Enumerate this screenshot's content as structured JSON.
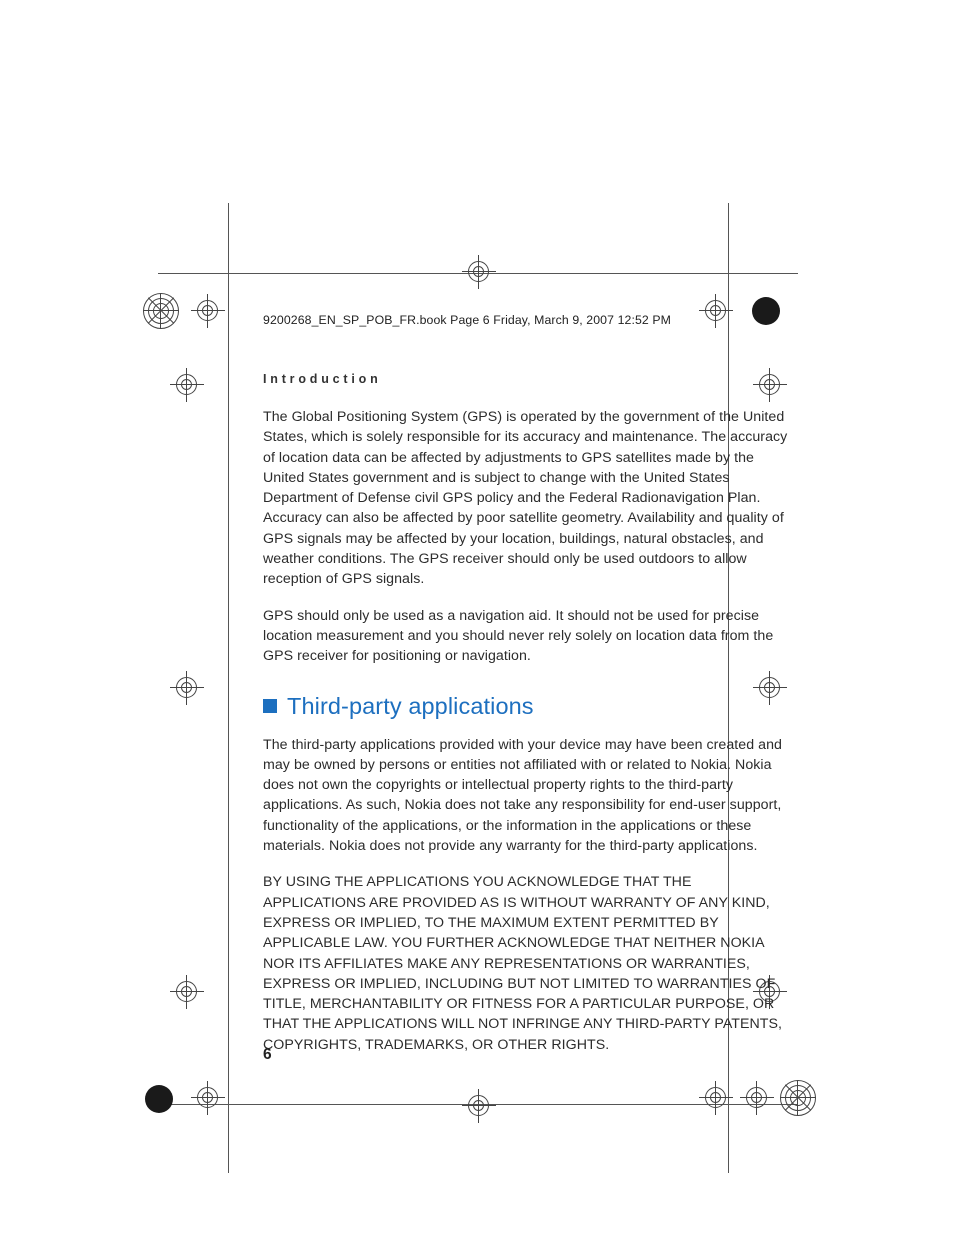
{
  "header_line": "9200268_EN_SP_POB_FR.book  Page 6  Friday, March 9, 2007  12:52 PM",
  "section_label": "Introduction",
  "paragraphs": {
    "p1": "The Global Positioning System (GPS) is operated by the government of the United States, which is solely responsible for its accuracy and maintenance. The accuracy of location data can be affected by adjustments to GPS satellites made by the United States government and is subject to change with the United States Department of Defense civil GPS policy and the Federal Radionavigation Plan. Accuracy can also be affected by poor satellite geometry. Availability and quality of GPS signals may be affected by your location, buildings, natural obstacles, and weather conditions. The GPS receiver should only be used outdoors to allow reception of GPS signals.",
    "p2": "GPS should only be used as a navigation aid. It should not be used for precise location measurement and you should never rely solely on location data from the GPS receiver for positioning or navigation.",
    "p3": "The third-party applications provided with your device may have been created and may be owned by persons or entities not affiliated with or related to Nokia. Nokia does not own the copyrights or intellectual property rights to the third-party applications. As such, Nokia does not take any responsibility for end-user support, functionality of the applications, or the information in the applications or these materials. Nokia does not provide any warranty for the third-party applications.",
    "p4": "BY USING THE APPLICATIONS YOU ACKNOWLEDGE THAT THE APPLICATIONS ARE PROVIDED AS IS WITHOUT WARRANTY OF ANY KIND, EXPRESS OR IMPLIED, TO THE MAXIMUM EXTENT PERMITTED BY APPLICABLE LAW. YOU FURTHER ACKNOWLEDGE THAT NEITHER NOKIA NOR ITS AFFILIATES MAKE ANY REPRESENTATIONS OR WARRANTIES, EXPRESS OR IMPLIED, INCLUDING BUT NOT LIMITED TO WARRANTIES OF TITLE, MERCHANTABILITY OR FITNESS FOR A PARTICULAR PURPOSE, OR THAT THE APPLICATIONS WILL NOT INFRINGE ANY THIRD-PARTY PATENTS, COPYRIGHTS, TRADEMARKS, OR OTHER RIGHTS."
  },
  "section_heading": "Third-party applications",
  "page_number": "6"
}
